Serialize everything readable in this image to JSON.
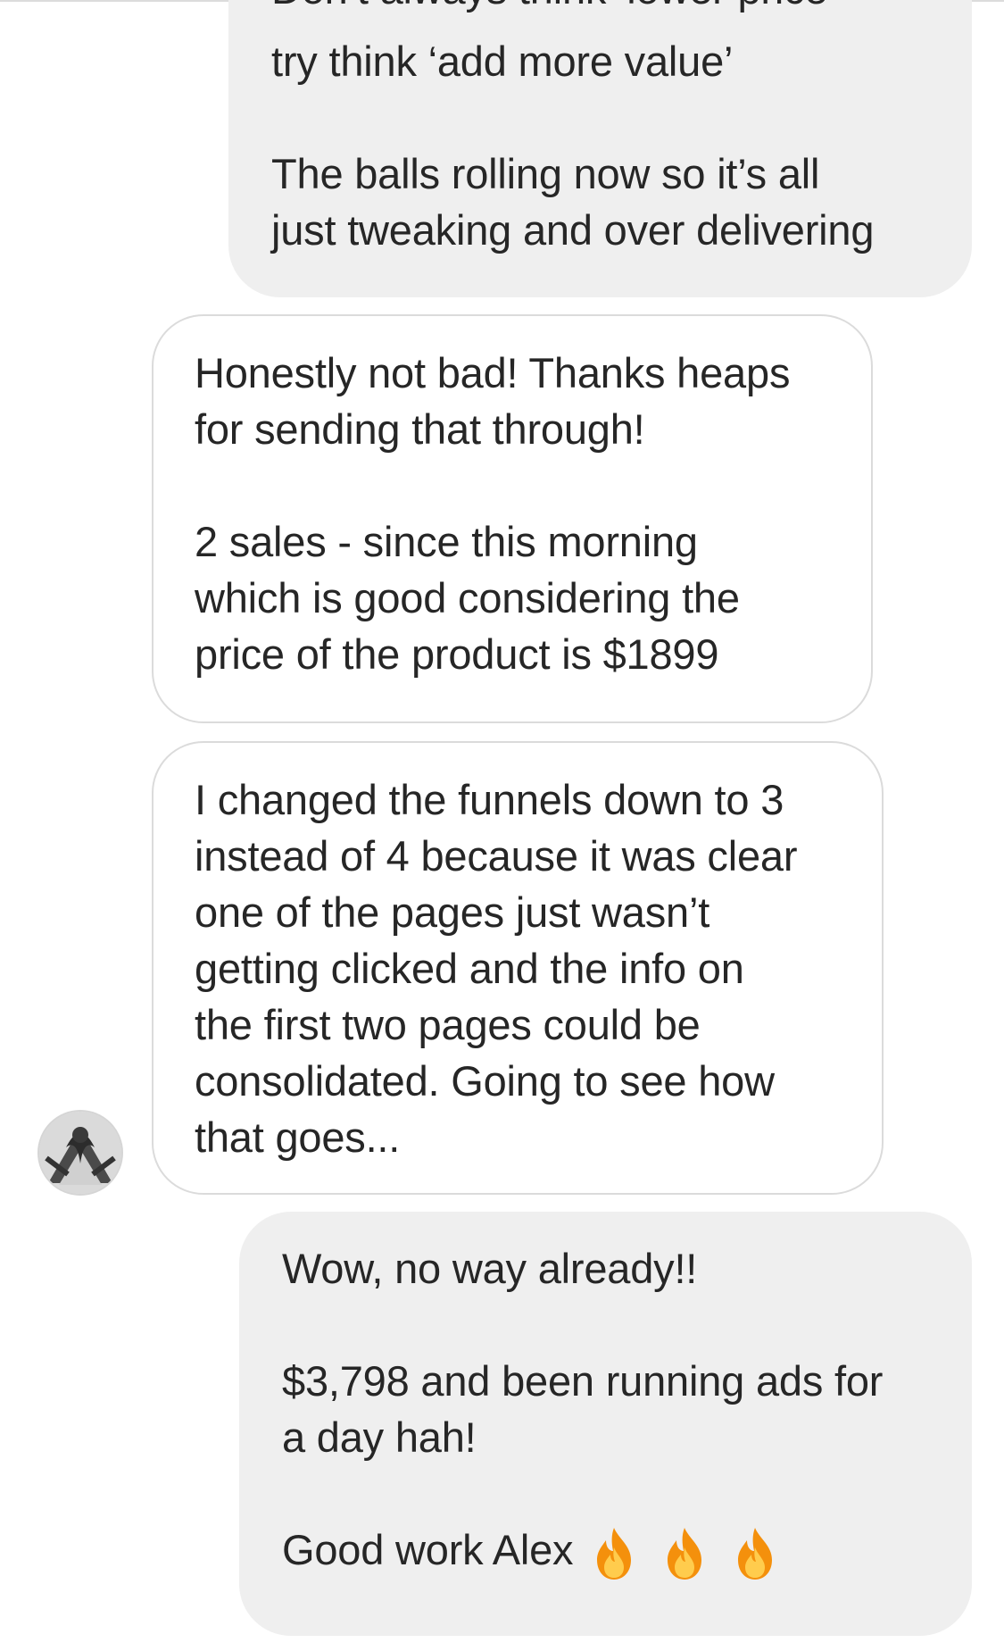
{
  "conversation": {
    "bubble1": {
      "cut_line": "Don’t always think ‘lower price’",
      "line1": "try think ‘add more value’",
      "line2": "The balls rolling now so it’s all",
      "line3": "just tweaking and over delivering"
    },
    "bubble2": {
      "line1": "Honestly not bad! Thanks heaps",
      "line2": "for sending that through!",
      "line3": "2 sales - since this morning",
      "line4": "which is good considering the",
      "line5": "price of the product is $1899"
    },
    "bubble3": {
      "line1": "I changed the funnels down to 3",
      "line2": "instead of 4 because it was clear",
      "line3": "one of the pages just wasn’t",
      "line4": "getting clicked and the info on",
      "line5": "the first two pages could be",
      "line6": "consolidated. Going to see how",
      "line7": "that goes..."
    },
    "bubble4": {
      "line1": "Wow, no way already!!",
      "line2": "$3,798 and been running ads for",
      "line3": "a day hah!",
      "line4": "Good work Alex",
      "emojis": [
        "fire-icon",
        "fire-icon",
        "fire-icon"
      ]
    },
    "avatar_icon": "user-avatar"
  },
  "colors": {
    "sent_bubble": "#efefef",
    "received_border": "#dbdbdb",
    "text": "#262626"
  }
}
